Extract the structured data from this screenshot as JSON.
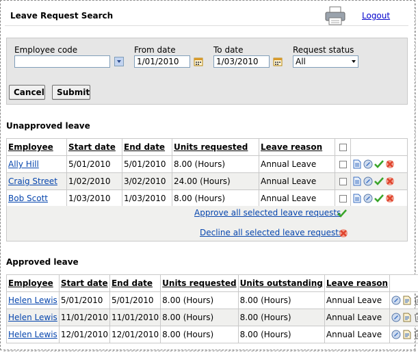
{
  "header": {
    "title": "Leave Request Search",
    "logout": "Logout"
  },
  "search": {
    "employee_code_label": "Employee code",
    "employee_code_value": "",
    "from_date_label": "From date",
    "from_date_value": "1/01/2010",
    "to_date_label": "To date",
    "to_date_value": "1/03/2010",
    "status_label": "Request status",
    "status_value": "All",
    "cancel_label": "Cancel",
    "submit_label": "Submit"
  },
  "unapproved": {
    "title": "Unapproved leave",
    "columns": [
      "Employee",
      "Start date",
      "End date",
      "Units requested",
      "Leave reason"
    ],
    "rows": [
      {
        "employee": "Ally Hill",
        "start": "5/01/2010",
        "end": "5/01/2010",
        "units": "8.00 (Hours)",
        "reason": "Annual Leave"
      },
      {
        "employee": "Craig Street",
        "start": "1/02/2010",
        "end": "3/02/2010",
        "units": "24.00 (Hours)",
        "reason": "Annual Leave"
      },
      {
        "employee": "Bob Scott",
        "start": "1/03/2010",
        "end": "1/03/2010",
        "units": "8.00 (Hours)",
        "reason": "Annual Leave"
      }
    ],
    "approve_all": "Approve all selected leave requests",
    "decline_all": "Decline all selected leave requests"
  },
  "approved": {
    "title": "Approved leave",
    "columns": [
      "Employee",
      "Start date",
      "End date",
      "Units requested",
      "Units outstanding",
      "Leave reason"
    ],
    "rows": [
      {
        "employee": "Helen Lewis",
        "start": "5/01/2010",
        "end": "5/01/2010",
        "units": "8.00 (Hours)",
        "outstanding": "8.00 (Hours)",
        "reason": "Annual Leave"
      },
      {
        "employee": "Helen Lewis",
        "start": "11/01/2010",
        "end": "11/01/2010",
        "units": "8.00 (Hours)",
        "outstanding": "8.00 (Hours)",
        "reason": "Annual Leave"
      },
      {
        "employee": "Helen Lewis",
        "start": "12/01/2010",
        "end": "12/01/2010",
        "units": "8.00 (Hours)",
        "outstanding": "8.00 (Hours)",
        "reason": "Annual Leave"
      }
    ]
  },
  "icons": {
    "print": "printer-icon",
    "calendar": "calendar-icon",
    "view": "document-icon",
    "edit": "edit-icon",
    "approve": "checkmark-icon",
    "decline": "cross-icon",
    "delete": "trash-icon"
  },
  "colors": {
    "link": "#0645ad",
    "approve": "#3aa52a",
    "decline": "#e0432c",
    "panel": "#e6e6e6"
  }
}
